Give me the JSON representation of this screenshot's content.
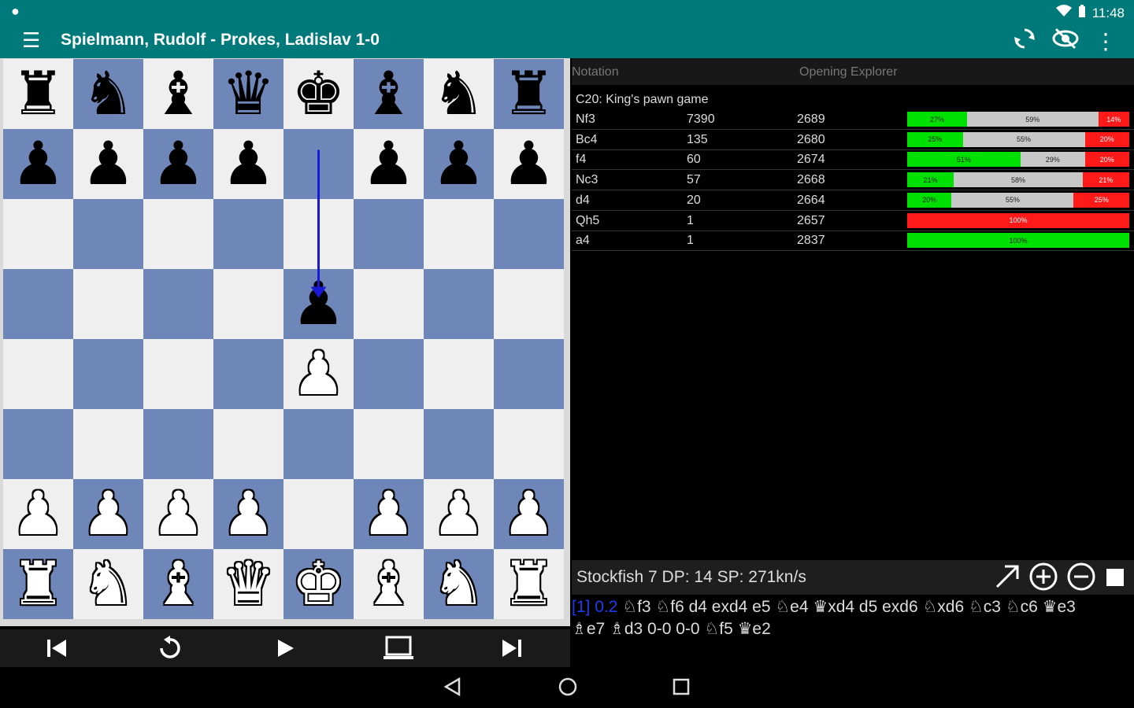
{
  "status_bar": {
    "left_icon": "notification-icon",
    "right_icons": [
      "wifi-icon",
      "battery-icon"
    ],
    "time": "11:48"
  },
  "app_bar": {
    "title": "Spielmann, Rudolf - Prokes, Ladislav 1-0",
    "menu_icon": "menu-icon",
    "actions": [
      "flip-board-icon",
      "hide-icon",
      "overflow-menu-icon"
    ]
  },
  "board": {
    "files": [
      "a",
      "b",
      "c",
      "d",
      "e",
      "f",
      "g",
      "h"
    ],
    "ranks": [
      [
        "br",
        "bn",
        "bb",
        "bq",
        "bk",
        "bb",
        "bn",
        "br"
      ],
      [
        "bp",
        "bp",
        "bp",
        "bp",
        "",
        "bp",
        "bp",
        "bp"
      ],
      [
        "",
        "",
        "",
        "",
        "",
        "",
        "",
        ""
      ],
      [
        "",
        "",
        "",
        "",
        "bp",
        "",
        "",
        ""
      ],
      [
        "",
        "",
        "",
        "",
        "wp",
        "",
        "",
        ""
      ],
      [
        "",
        "",
        "",
        "",
        "",
        "",
        "",
        ""
      ],
      [
        "wp",
        "wp",
        "wp",
        "wp",
        "",
        "wp",
        "wp",
        "wp"
      ],
      [
        "wr",
        "wn",
        "wb",
        "wq",
        "wk",
        "wb",
        "wn",
        "wr"
      ]
    ],
    "last_move": {
      "from": "e7",
      "to": "e5"
    }
  },
  "nav_bar": {
    "buttons": [
      "skip-to-start-icon",
      "undo-icon",
      "play-icon",
      "computer-icon",
      "skip-to-end-icon"
    ]
  },
  "explorer": {
    "tabs": [
      "Notation",
      "Opening Explorer"
    ],
    "opening": "C20: King's pawn game",
    "rows": [
      {
        "move": "Nf3",
        "games": "7390",
        "elo": "2689",
        "win": 27,
        "draw": 59,
        "loss": 14,
        "win_label": "27%",
        "draw_label": "59%",
        "loss_label": "14%"
      },
      {
        "move": "Bc4",
        "games": "135",
        "elo": "2680",
        "win": 25,
        "draw": 55,
        "loss": 20,
        "win_label": "25%",
        "draw_label": "55%",
        "loss_label": "20%"
      },
      {
        "move": "f4",
        "games": "60",
        "elo": "2674",
        "win": 51,
        "draw": 29,
        "loss": 20,
        "win_label": "51%",
        "draw_label": "29%",
        "loss_label": "20%"
      },
      {
        "move": "Nc3",
        "games": "57",
        "elo": "2668",
        "win": 21,
        "draw": 58,
        "loss": 21,
        "win_label": "21%",
        "draw_label": "58%",
        "loss_label": "21%"
      },
      {
        "move": "d4",
        "games": "20",
        "elo": "2664",
        "win": 20,
        "draw": 55,
        "loss": 25,
        "win_label": "20%",
        "draw_label": "55%",
        "loss_label": "25%"
      },
      {
        "move": "Qh5",
        "games": "1",
        "elo": "2657",
        "win": 0,
        "draw": 0,
        "loss": 100,
        "win_label": "",
        "draw_label": "",
        "loss_label": "100%"
      },
      {
        "move": "a4",
        "games": "1",
        "elo": "2837",
        "win": 100,
        "draw": 0,
        "loss": 0,
        "win_label": "100%",
        "draw_label": "",
        "loss_label": ""
      }
    ]
  },
  "engine": {
    "info": "Stockfish 7 DP: 14 SP: 271kn/s",
    "controls": [
      "arrow-up-right-icon",
      "plus-circle-icon",
      "minus-circle-icon",
      "stop-icon"
    ],
    "pv_depth": "[1]",
    "pv_score": "0.2",
    "pv_line_1": "♘f3 ♘f6 d4 exd4 e5 ♘e4 ♛xd4 d5 exd6 ♘xd6 ♘c3 ♘c6 ♛e3",
    "pv_line_2": "♗e7 ♗d3 0-0 0-0 ♘f5 ♛e2"
  },
  "system_nav": [
    "back-icon",
    "home-icon",
    "recents-icon"
  ]
}
